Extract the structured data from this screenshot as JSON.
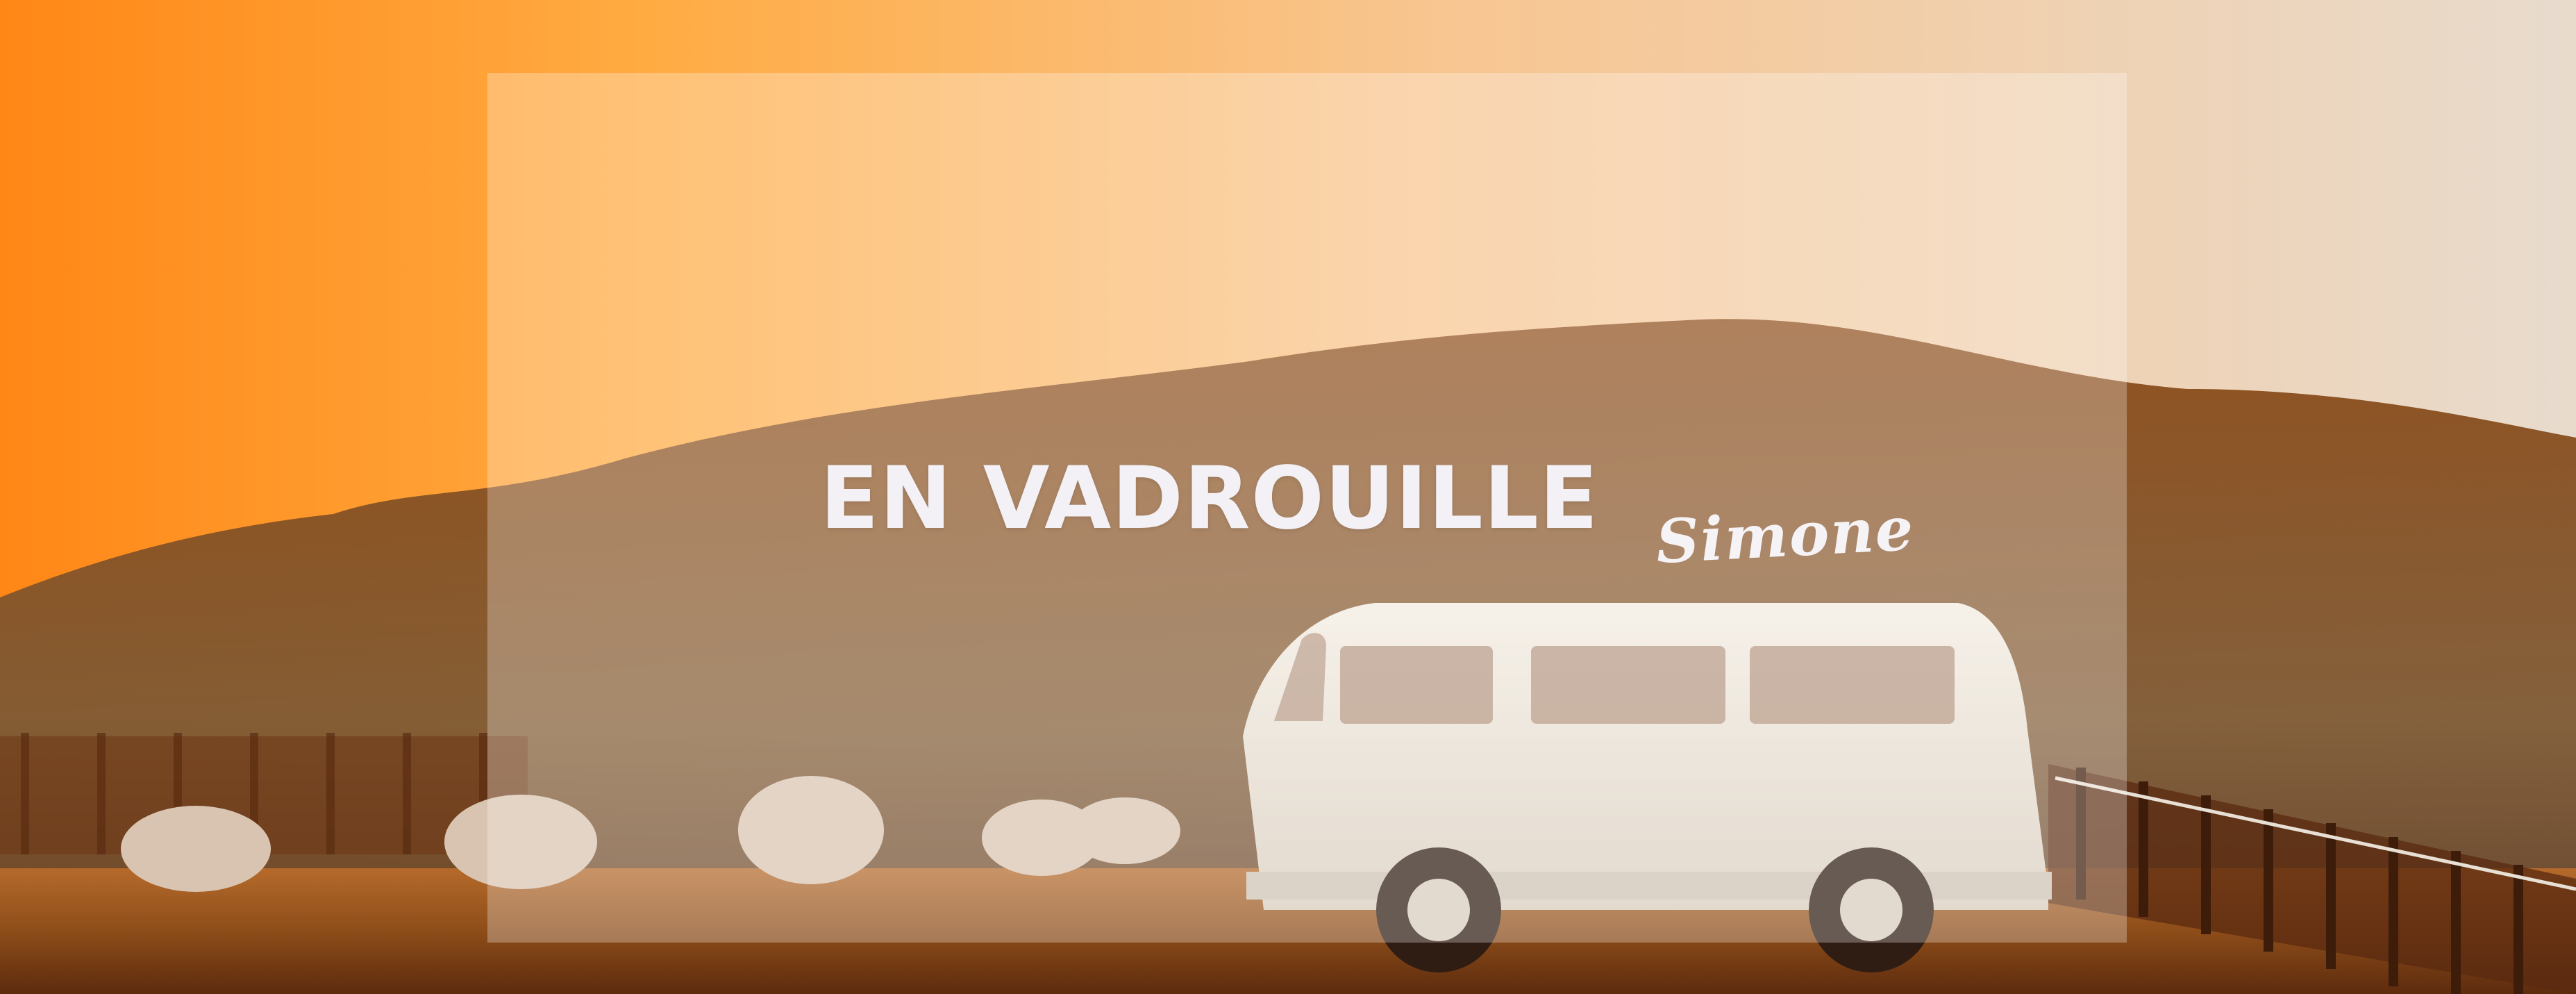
{
  "banner": {
    "title": "EN VADROUILLE",
    "signature": "Simone"
  },
  "colors": {
    "sky_orange": "#ff8a1f",
    "sky_light": "#f3c89a",
    "hill": "#8a5124",
    "ground": "#7a3f14",
    "van_body": "#e8ddd0",
    "overlay": "#ffffff"
  }
}
